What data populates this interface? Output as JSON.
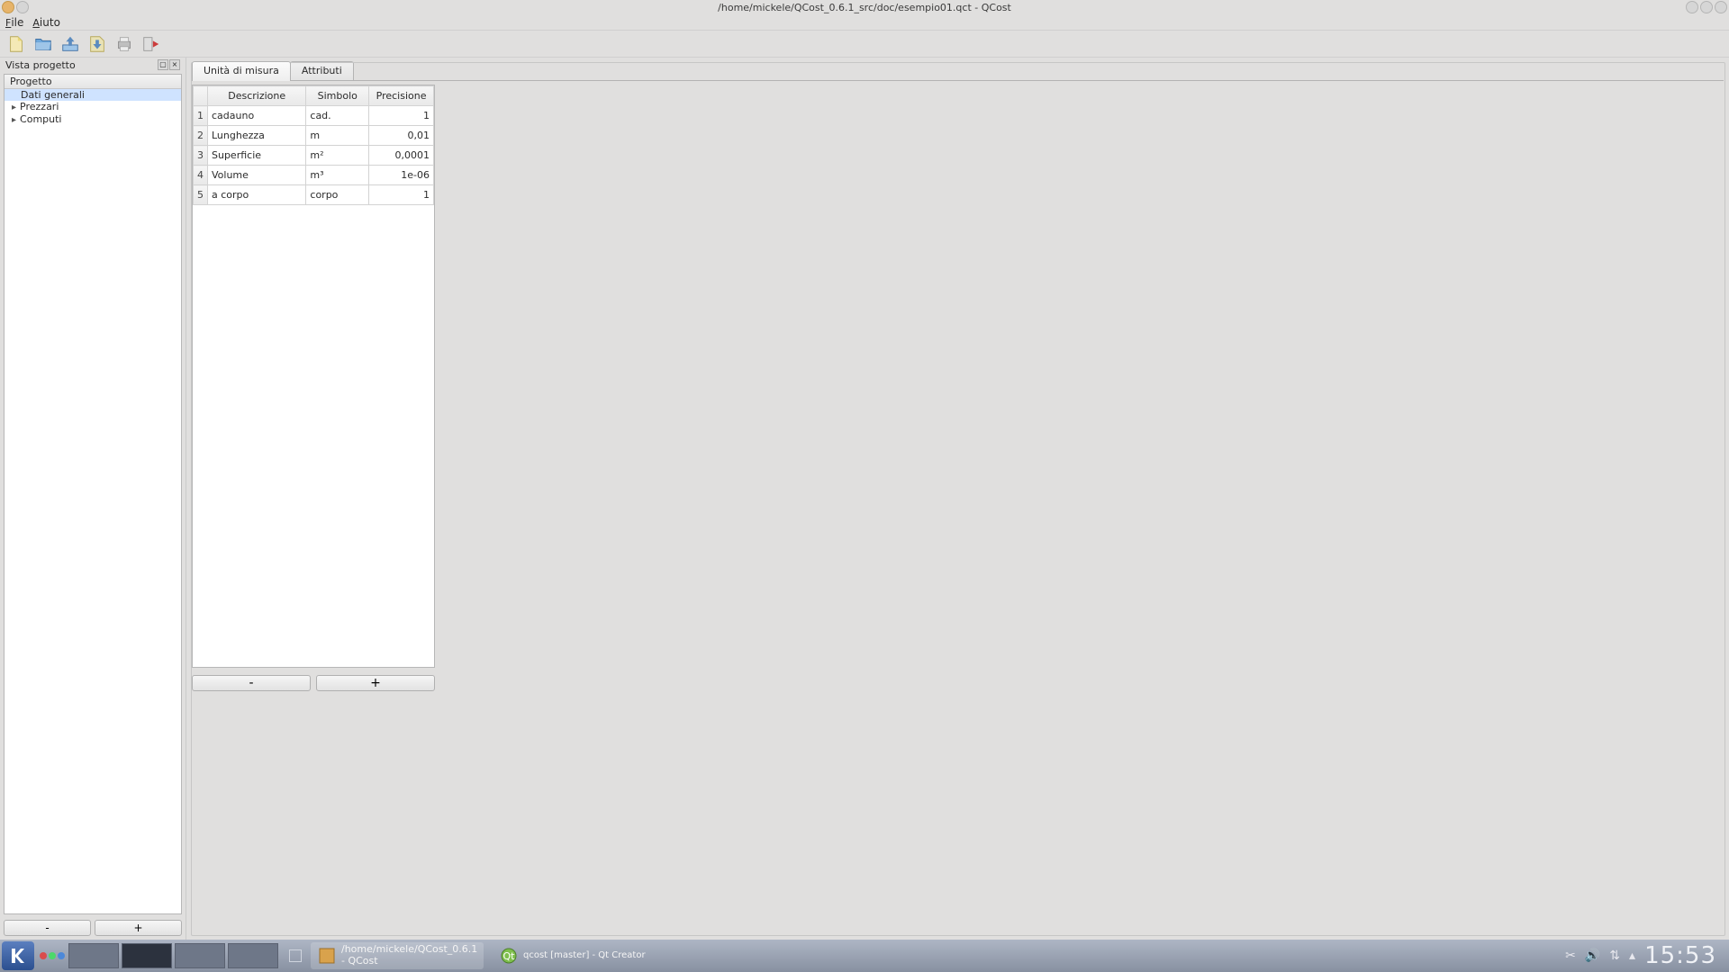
{
  "window": {
    "title": "/home/mickele/QCost_0.6.1_src/doc/esempio01.qct - QCost"
  },
  "menubar": {
    "file": "File",
    "aiuto": "Aiuto"
  },
  "dock": {
    "title": "Vista progetto",
    "tree_header": "Progetto",
    "items": [
      {
        "label": "Dati generali",
        "selected": true,
        "expandable": false
      },
      {
        "label": "Prezzari",
        "selected": false,
        "expandable": true
      },
      {
        "label": "Computi",
        "selected": false,
        "expandable": true
      }
    ],
    "btn_remove": "-",
    "btn_add": "+"
  },
  "tabs": {
    "unit": "Unità di misura",
    "attr": "Attributi",
    "active": 0
  },
  "table": {
    "headers": {
      "desc": "Descrizione",
      "sym": "Simbolo",
      "prec": "Precisione"
    },
    "rows": [
      {
        "n": "1",
        "desc": "cadauno",
        "sym": "cad.",
        "prec": "1"
      },
      {
        "n": "2",
        "desc": "Lunghezza",
        "sym": "m",
        "prec": "0,01"
      },
      {
        "n": "3",
        "desc": "Superficie",
        "sym": "m²",
        "prec": "0,0001"
      },
      {
        "n": "4",
        "desc": "Volume",
        "sym": "m³",
        "prec": "1e-06"
      },
      {
        "n": "5",
        "desc": "a corpo",
        "sym": "corpo",
        "prec": "1"
      }
    ],
    "btn_remove": "-",
    "btn_add": "+"
  },
  "taskbar": {
    "entries": [
      {
        "title_line1": "/home/mickele/QCost_0.6.1",
        "title_line2": "- QCost",
        "active": true
      },
      {
        "title_line1": "qcost [master] - Qt Creator",
        "title_line2": "",
        "active": false
      }
    ],
    "clock": "15:53"
  }
}
